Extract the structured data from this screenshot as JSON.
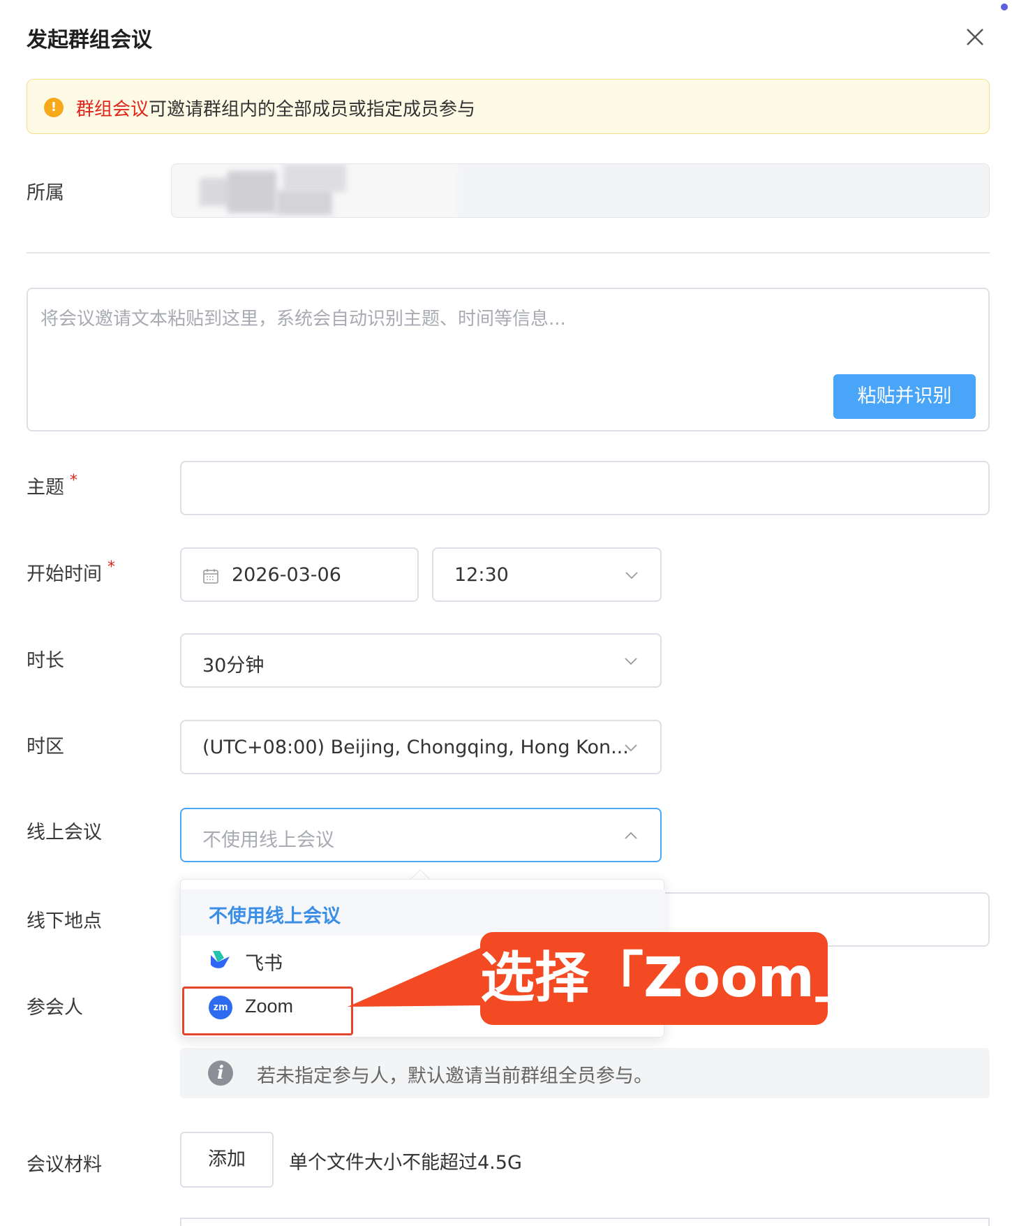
{
  "dialog": {
    "title": "发起群组会议"
  },
  "notice": {
    "highlight": "群组会议",
    "text": "可邀请群组内的全部成员或指定成员参与",
    "icon": "warning-icon"
  },
  "form": {
    "belong_label": "所属",
    "paste": {
      "placeholder": "将会议邀请文本粘贴到这里，系统会自动识别主题、时间等信息...",
      "button": "粘贴并识别"
    },
    "subject": {
      "label": "主题",
      "required_mark": "*",
      "value": ""
    },
    "start_time": {
      "label": "开始时间",
      "required_mark": "*",
      "date": "2026-03-06",
      "time": "12:30"
    },
    "duration": {
      "label": "时长",
      "value": "30分钟"
    },
    "timezone": {
      "label": "时区",
      "value": "(UTC+08:00) Beijing, Chongqing, Hong Kon..."
    },
    "online": {
      "label": "线上会议",
      "placeholder": "不使用线上会议",
      "options": [
        {
          "label": "不使用线上会议",
          "icon": ""
        },
        {
          "label": "飞书",
          "icon": "feishu-icon"
        },
        {
          "label": "Zoom",
          "icon": "zoom-icon"
        }
      ]
    },
    "offline": {
      "label": "线下地点"
    },
    "participants": {
      "label": "参会人",
      "info": "若未指定参与人，默认邀请当前群组全员参与。"
    },
    "materials": {
      "label": "会议材料",
      "add_button": "添加",
      "hint": "单个文件大小不能超过4.5G"
    }
  },
  "callout": {
    "text": "选择「Zoom」"
  },
  "colors": {
    "accent": "#49a5f7",
    "callout": "#f34a23",
    "required": "#e0251a",
    "dropdown_active": "#3a8ee6"
  }
}
